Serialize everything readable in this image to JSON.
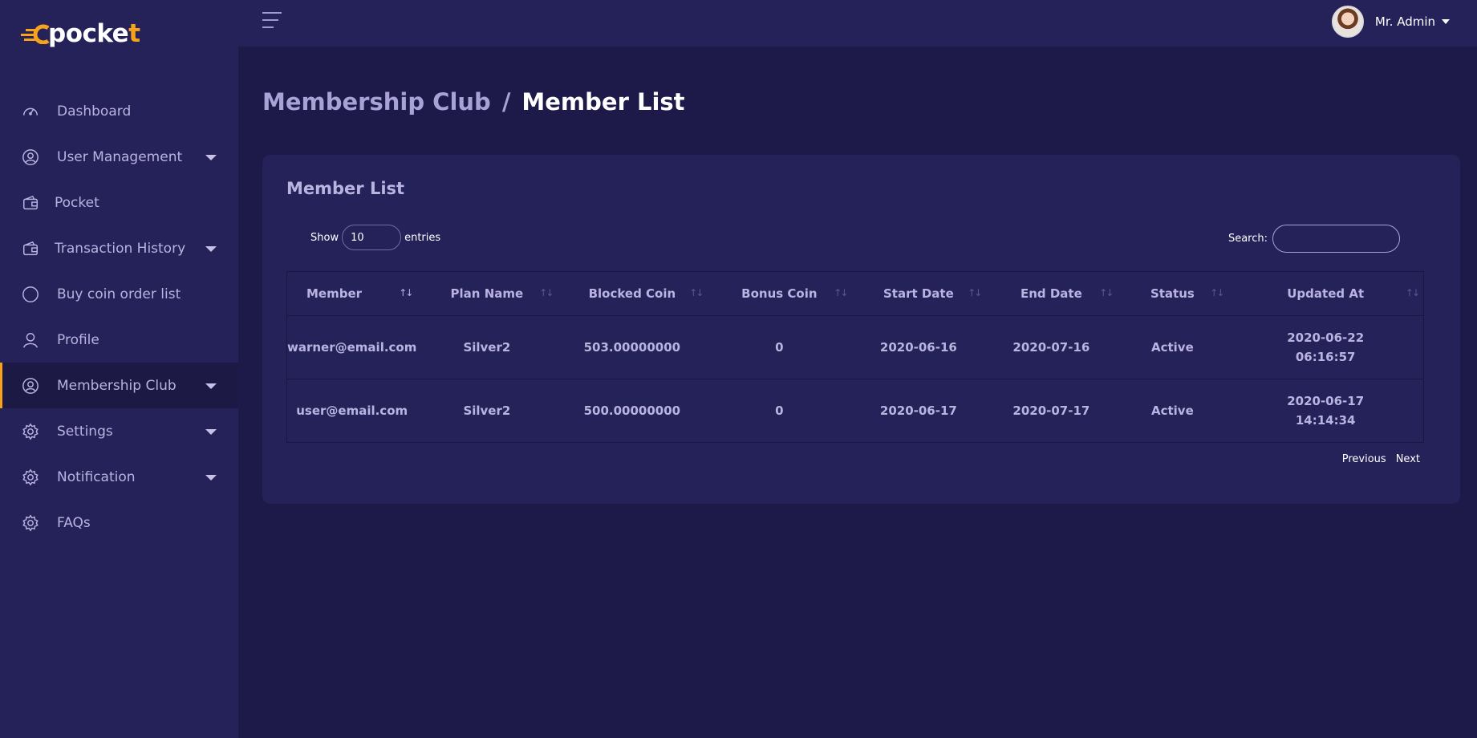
{
  "brand": {
    "name_main": "pocke",
    "name_accent": "t",
    "name_prefix": "c",
    "accent_color": "#f7a21b"
  },
  "sidebar": {
    "items": [
      {
        "label": "Dashboard",
        "icon": "speedometer-icon",
        "has_caret": false
      },
      {
        "label": "User Management",
        "icon": "user-circle-icon",
        "has_caret": true
      },
      {
        "label": "Pocket",
        "icon": "wallet-icon",
        "has_caret": false
      },
      {
        "label": "Transaction History",
        "icon": "wallet-icon",
        "has_caret": true
      },
      {
        "label": "Buy coin order list",
        "icon": "circle-icon",
        "has_caret": false
      },
      {
        "label": "Profile",
        "icon": "person-icon",
        "has_caret": false
      },
      {
        "label": "Membership Club",
        "icon": "user-circle-icon",
        "has_caret": true,
        "active": true
      },
      {
        "label": "Settings",
        "icon": "gear-icon",
        "has_caret": true
      },
      {
        "label": "Notification",
        "icon": "gear-icon",
        "has_caret": true
      },
      {
        "label": "FAQs",
        "icon": "gear-icon",
        "has_caret": false
      }
    ]
  },
  "topbar": {
    "user_name": "Mr. Admin"
  },
  "breadcrumb": {
    "parent": "Membership Club",
    "separator": "/",
    "current": "Member List"
  },
  "card": {
    "title": "Member List",
    "length": {
      "show": "Show",
      "value": "10",
      "entries": "entries"
    },
    "search": {
      "label": "Search:",
      "value": ""
    },
    "columns": [
      "Member",
      "Plan Name",
      "Blocked Coin",
      "Bonus Coin",
      "Start Date",
      "End Date",
      "Status",
      "Updated At"
    ],
    "rows": [
      {
        "member": "warner@email.com",
        "plan": "Silver2",
        "blocked": "503.00000000",
        "bonus": "0",
        "start": "2020-06-16",
        "end": "2020-07-16",
        "status": "Active",
        "updated_date": "2020-06-22",
        "updated_time": "06:16:57"
      },
      {
        "member": "user@email.com",
        "plan": "Silver2",
        "blocked": "500.00000000",
        "bonus": "0",
        "start": "2020-06-17",
        "end": "2020-07-17",
        "status": "Active",
        "updated_date": "2020-06-17",
        "updated_time": "14:14:34"
      }
    ],
    "pager": {
      "previous": "Previous",
      "next": "Next"
    }
  }
}
